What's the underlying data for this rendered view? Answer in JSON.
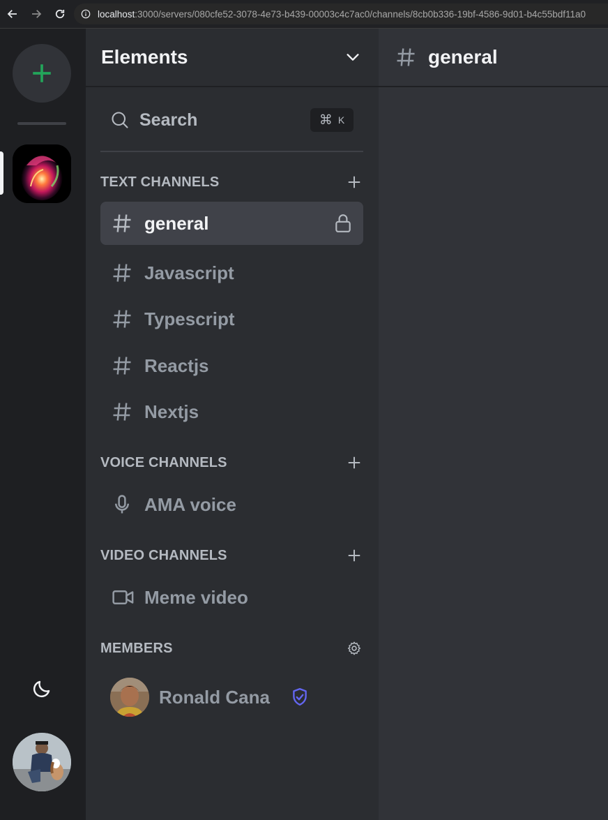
{
  "browser": {
    "url_host": "localhost",
    "url_rest": ":3000/servers/080cfe52-3078-4e73-b439-00003c4c7ac0/channels/8cb0b336-19bf-4586-9d01-b4c55bdf11a0"
  },
  "rail": {
    "add_server_icon": "plus-icon",
    "theme_icon": "moon-icon",
    "accent_color": "#23a55a"
  },
  "server": {
    "name": "Elements"
  },
  "search": {
    "label": "Search",
    "shortcut_symbol": "⌘",
    "shortcut_key": "K"
  },
  "sections": {
    "text": {
      "label": "TEXT CHANNELS"
    },
    "voice": {
      "label": "VOICE CHANNELS"
    },
    "video": {
      "label": "VIDEO CHANNELS"
    },
    "members": {
      "label": "MEMBERS"
    }
  },
  "text_channels": [
    {
      "name": "general",
      "active": true,
      "locked": true
    },
    {
      "name": "Javascript"
    },
    {
      "name": "Typescript"
    },
    {
      "name": "Reactjs"
    },
    {
      "name": "Nextjs"
    }
  ],
  "voice_channels": [
    {
      "name": "AMA voice"
    }
  ],
  "video_channels": [
    {
      "name": "Meme video"
    }
  ],
  "members": [
    {
      "name": "Ronald Cana",
      "role_icon": "shield-check-icon",
      "role_color": "#6366f1"
    }
  ],
  "main": {
    "channel_title": "general"
  }
}
